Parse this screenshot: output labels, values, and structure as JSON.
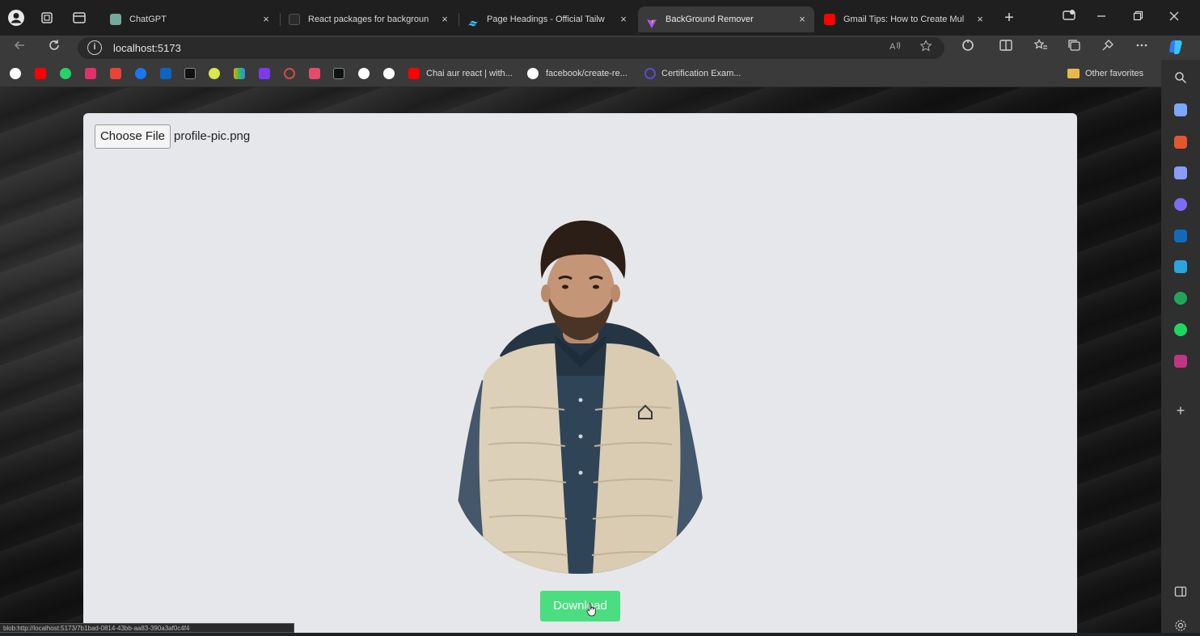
{
  "browser": {
    "tabs": [
      {
        "title": "ChatGPT",
        "favicon_color": "#74aa9c",
        "active": false
      },
      {
        "title": "React packages for backgroun",
        "favicon_color": "#2b2b2b",
        "active": false
      },
      {
        "title": "Page Headings - Official Tailw",
        "favicon_color": "#38bdf8",
        "active": false
      },
      {
        "title": "BackGround Remover",
        "favicon_color": "#a855f7",
        "active": true
      },
      {
        "title": "Gmail Tips: How to Create Mul",
        "favicon_color": "#ff0000",
        "active": false
      }
    ],
    "tab_close_glyph": "×",
    "new_tab_glyph": "+",
    "address": {
      "url": "localhost:5173"
    },
    "bookmarks": [
      {
        "label": "Chai aur react | with...",
        "icon_color": "#ff0000"
      },
      {
        "label": "facebook/create-re...",
        "icon_color": "#ffffff"
      },
      {
        "label": "Certification Exam...",
        "icon_color": "#5b4bd5"
      }
    ],
    "other_favorites": "Other favorites",
    "status_bar": "blob:http://localhost:5173/7b1bad-0814-43bb-aa83-390a3af0c4f4"
  },
  "page": {
    "choose_file_label": "Choose File",
    "file_name": "profile-pic.png",
    "download_label": "Download",
    "accent_color": "#4ade80"
  }
}
